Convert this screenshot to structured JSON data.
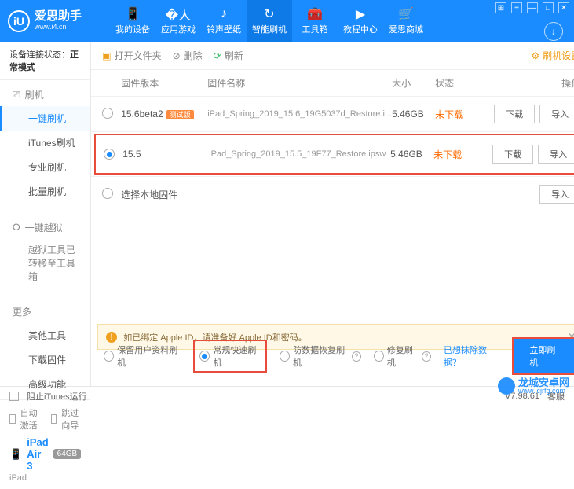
{
  "brand": {
    "name": "爱思助手",
    "url": "www.i4.cn",
    "logo_letter": "iU"
  },
  "win": {
    "grid": "⊞",
    "opts": "≡",
    "min": "—",
    "max": "□",
    "close": "✕"
  },
  "nav": [
    {
      "label": "我的设备",
      "icon": "📱"
    },
    {
      "label": "应用游戏",
      "icon": "�人"
    },
    {
      "label": "铃声壁纸",
      "icon": "♪"
    },
    {
      "label": "智能刷机",
      "icon": "↻",
      "active": true
    },
    {
      "label": "工具箱",
      "icon": "🧰"
    },
    {
      "label": "教程中心",
      "icon": "▶"
    },
    {
      "label": "爱思商城",
      "icon": "🛒"
    }
  ],
  "download_icon": "↓",
  "conn": {
    "prefix": "设备连接状态：",
    "mode": "正常模式"
  },
  "side": {
    "flash": {
      "head": "刷机",
      "items": [
        "一键刷机",
        "iTunes刷机",
        "专业刷机",
        "批量刷机"
      ]
    },
    "jailbreak": {
      "head": "一键越狱",
      "note": "越狱工具已转移至工具箱"
    },
    "more": {
      "head": "更多",
      "items": [
        "其他工具",
        "下载固件",
        "高级功能"
      ]
    }
  },
  "device": {
    "auto_activate": "自动激活",
    "skip": "跳过向导",
    "name": "iPad Air 3",
    "storage": "64GB",
    "type": "iPad"
  },
  "toolbar": {
    "open": "打开文件夹",
    "del": "删除",
    "refresh": "刷新",
    "settings": "刷机设置"
  },
  "columns": {
    "ver": "固件版本",
    "name": "固件名称",
    "size": "大小",
    "status": "状态",
    "ops": "操作"
  },
  "rows": [
    {
      "ver": "15.6beta2",
      "tag": "测试版",
      "name": "iPad_Spring_2019_15.6_19G5037d_Restore.i...",
      "size": "5.46GB",
      "status": "未下载",
      "selected": false
    },
    {
      "ver": "15.5",
      "tag": "",
      "name": "iPad_Spring_2019_15.5_19F77_Restore.ipsw",
      "size": "5.46GB",
      "status": "未下载",
      "selected": true
    }
  ],
  "local_fw": "选择本地固件",
  "btns": {
    "download": "下载",
    "import": "导入"
  },
  "banner": {
    "icon": "!",
    "text": "如已绑定 Apple ID，请准备好 Apple ID和密码。"
  },
  "opts": {
    "keep": "保留用户资料刷机",
    "fast": "常规快速刷机",
    "antirec": "防数据恢复刷机",
    "repair": "修复刷机",
    "clear_link": "已想抹除数据？",
    "flash": "立即刷机"
  },
  "footer": {
    "block": "阻止iTunes运行",
    "ver": "V7.98.61",
    "cs": "客服"
  },
  "watermark": {
    "text": "龙城安卓网",
    "url": "www.lcjrfg.com"
  }
}
